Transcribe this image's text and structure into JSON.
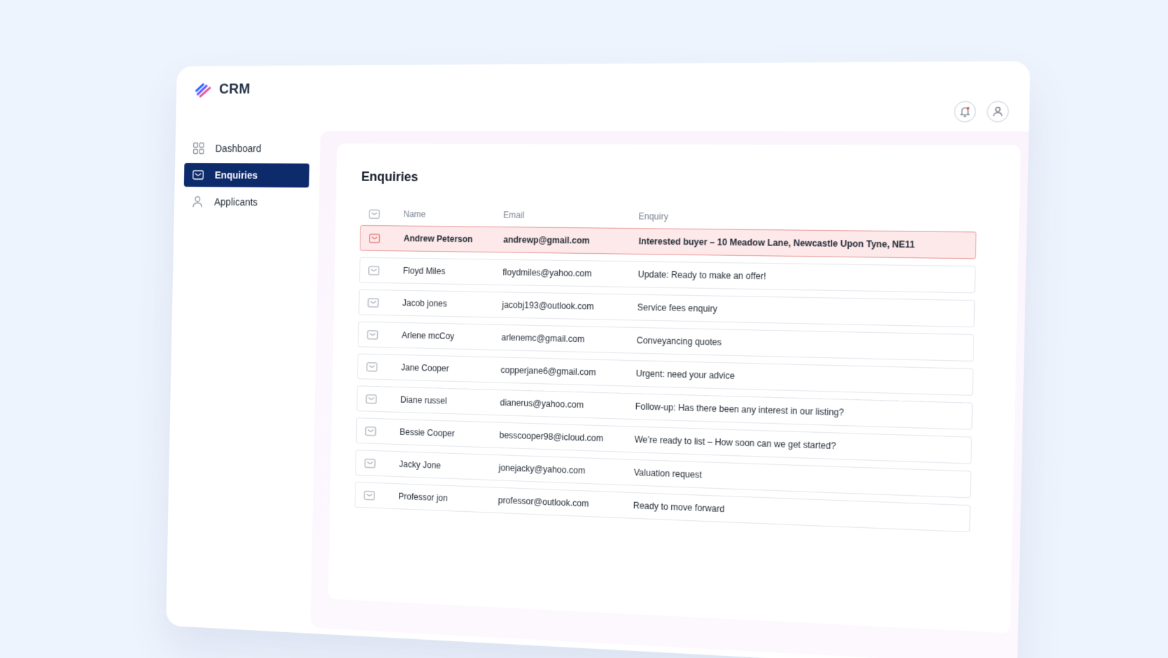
{
  "app": {
    "logo_text": "CRM",
    "logo_icon": "stripes-logo-icon"
  },
  "sidebar": {
    "items": [
      {
        "label": "Dashboard",
        "icon": "grid-icon",
        "active": false
      },
      {
        "label": "Enquiries",
        "icon": "mail-icon",
        "active": true
      },
      {
        "label": "Applicants",
        "icon": "user-icon",
        "active": false
      }
    ]
  },
  "header": {
    "icons": [
      "bell-icon",
      "profile-icon"
    ]
  },
  "main": {
    "title": "Enquiries",
    "columns": {
      "name": "Name",
      "email": "Email",
      "enquiry": "Enquiry"
    },
    "rows": [
      {
        "name": "Andrew Peterson",
        "email": "andrewp@gmail.com",
        "enquiry": "Interested buyer – 10 Meadow Lane, Newcastle Upon Tyne, NE11",
        "selected": true
      },
      {
        "name": "Floyd Miles",
        "email": "floydmiles@yahoo.com",
        "enquiry": "Update: Ready to make an offer!",
        "selected": false
      },
      {
        "name": "Jacob jones",
        "email": "jacobj193@outlook.com",
        "enquiry": "Service fees enquiry",
        "selected": false
      },
      {
        "name": "Arlene mcCoy",
        "email": "arlenemc@gmail.com",
        "enquiry": "Conveyancing quotes",
        "selected": false
      },
      {
        "name": "Jane Cooper",
        "email": "copperjane6@gmail.com",
        "enquiry": "Urgent: need your advice",
        "selected": false
      },
      {
        "name": "Diane russel",
        "email": "dianerus@yahoo.com",
        "enquiry": "Follow-up: Has there been any interest in our listing?",
        "selected": false
      },
      {
        "name": "Bessie Cooper",
        "email": "besscooper98@icloud.com",
        "enquiry": "We’re ready to list – How soon can we get started?",
        "selected": false
      },
      {
        "name": "Jacky Jone",
        "email": "jonejacky@yahoo.com",
        "enquiry": "Valuation request",
        "selected": false
      },
      {
        "name": "Professor jon",
        "email": "professor@outlook.com",
        "enquiry": "Ready to move forward",
        "selected": false
      }
    ]
  },
  "colors": {
    "background": "#eef4fd",
    "nav_active": "#0d2a6b",
    "selected_row_bg": "#fde9e9",
    "selected_row_border": "#e99a9a",
    "icon_muted": "#9aa1ad",
    "icon_selected": "#d9534f"
  }
}
